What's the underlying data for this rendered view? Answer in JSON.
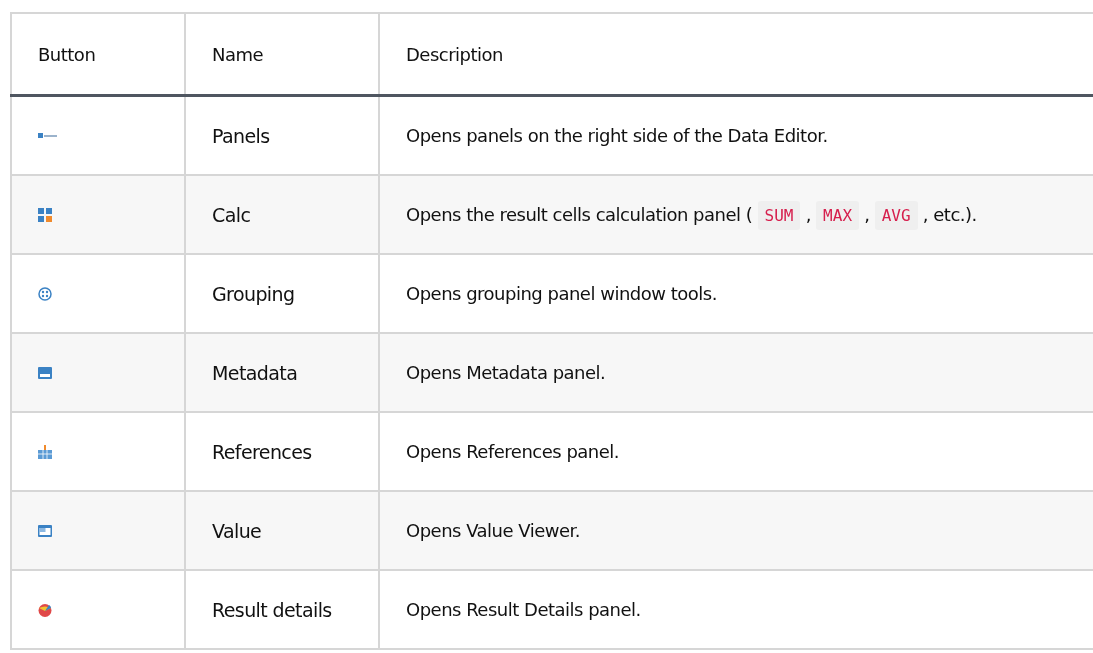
{
  "table": {
    "columns": [
      "Button",
      "Name",
      "Description"
    ],
    "rows": [
      {
        "name": "Panels",
        "description": [
          {
            "kind": "text",
            "text": "Opens panels on the right side of the Data Editor."
          }
        ]
      },
      {
        "name": "Calc",
        "description": [
          {
            "kind": "text",
            "text": "Opens the result cells calculation panel ( "
          },
          {
            "kind": "code",
            "text": "SUM"
          },
          {
            "kind": "text",
            "text": " , "
          },
          {
            "kind": "code",
            "text": "MAX"
          },
          {
            "kind": "text",
            "text": " , "
          },
          {
            "kind": "code",
            "text": "AVG"
          },
          {
            "kind": "text",
            "text": " , etc.)."
          }
        ]
      },
      {
        "name": "Grouping",
        "description": [
          {
            "kind": "text",
            "text": "Opens grouping panel window tools."
          }
        ]
      },
      {
        "name": "Metadata",
        "description": [
          {
            "kind": "text",
            "text": "Opens Metadata panel."
          }
        ]
      },
      {
        "name": "References",
        "description": [
          {
            "kind": "text",
            "text": "Opens References panel."
          }
        ]
      },
      {
        "name": "Value",
        "description": [
          {
            "kind": "text",
            "text": "Opens Value Viewer."
          }
        ]
      },
      {
        "name": "Result details",
        "description": [
          {
            "kind": "text",
            "text": "Opens Result Details panel."
          }
        ]
      }
    ]
  }
}
